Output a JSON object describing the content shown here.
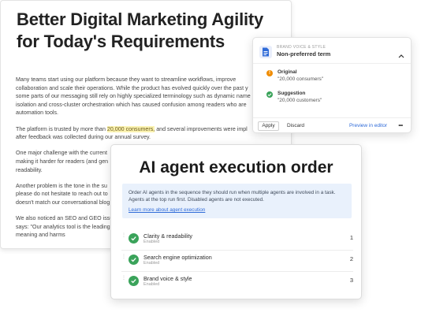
{
  "document": {
    "title": "Better Digital Marketing Agility for Today's Requirements",
    "paragraphs": [
      {
        "lines": [
          "Many teams start using our platform because they want to streamline workflows, improve",
          "collaboration and scale their operations. While the product has evolved quickly over the past y",
          "some parts of our messaging still rely on highly specialized terminology such as dynamic name",
          "isolation and cross-cluster orchestration  which has caused confusion among readers who are",
          "automation tools."
        ]
      },
      {
        "lines_a": [
          "The platform is trusted by more than "
        ],
        "highlight": "20,000 consumers,",
        "after_highlight": " and several improvements were impl",
        "line2": "after feedback was collected during our annual survey."
      },
      {
        "lines": [
          "One major challenge with the current",
          "making it harder for readers (and gen",
          "readability."
        ]
      },
      {
        "lines": [
          "Another problem is the tone in the su",
          "please do not hesitate to reach out to",
          "doesn't match our conversational blog"
        ]
      },
      {
        "lines": [
          "We also noticed an SEO and GEO issu",
          "says: \"Our analytics tool is the leading",
          "meaning and harms"
        ]
      }
    ]
  },
  "popover": {
    "eyebrow": "BRAND VOICE & STYLE",
    "heading": "Non-preferred term",
    "original_label": "Original",
    "original_value": "\"20,000 consumers\"",
    "suggestion_label": "Suggestion",
    "suggestion_value": "\"20,000 customers\"",
    "apply_label": "Apply",
    "discard_label": "Discard",
    "preview_label": "Preview in editor",
    "more_label": "•••",
    "icons": {
      "header": "document-icon",
      "collapse": "chevron-up-icon",
      "warning": "warning-icon",
      "success": "check-circle-icon"
    },
    "colors": {
      "warning": "#f08c00",
      "success": "#3aa35a",
      "link": "#2f6bd8"
    }
  },
  "agent_order": {
    "title": "AI agent execution order",
    "info_text": "Order AI agents in the sequence they should run when multiple agents are involved in a task. Agents at the top run first. Disabled agents are not executed.",
    "info_link": "Learn more about agent execution",
    "agents": [
      {
        "name": "Clarity & readability",
        "status": "Enabled",
        "order": "1"
      },
      {
        "name": "Search engine optimization",
        "status": "Enabled",
        "order": "2"
      },
      {
        "name": "Brand voice & style",
        "status": "Enabled",
        "order": "3"
      }
    ],
    "colors": {
      "enabled": "#3aa35a",
      "info_bg": "#e9f1fc"
    }
  }
}
